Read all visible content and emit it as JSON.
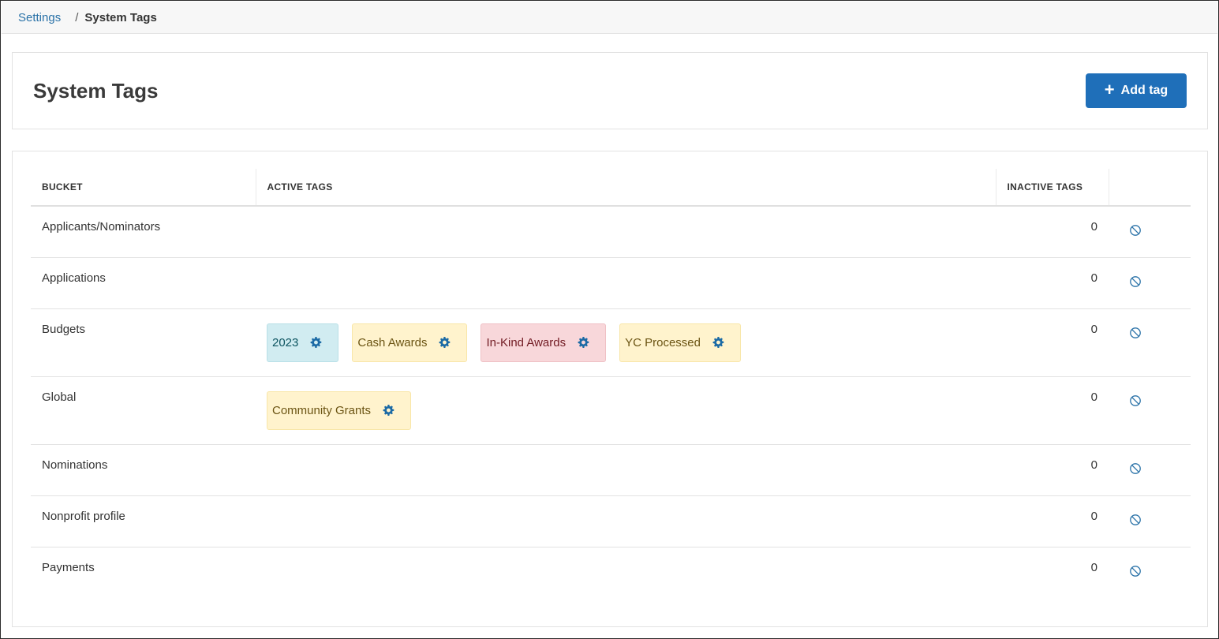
{
  "breadcrumb": {
    "parent": "Settings",
    "separator": "/",
    "current": "System Tags"
  },
  "header": {
    "title": "System Tags",
    "add_button_label": "Add tag",
    "add_button_icon": "plus-icon"
  },
  "colors": {
    "primary": "#1f6fb9",
    "link": "#2a72a8",
    "tag_info_bg": "#d1ecf1",
    "tag_warning_bg": "#fff3cd",
    "tag_danger_bg": "#f8d7da"
  },
  "table": {
    "columns": {
      "bucket": "BUCKET",
      "active": "ACTIVE TAGS",
      "inactive": "INACTIVE TAGS"
    },
    "rows": [
      {
        "bucket": "Applicants/Nominators",
        "tags": [],
        "inactive": "0"
      },
      {
        "bucket": "Applications",
        "tags": [],
        "inactive": "0"
      },
      {
        "bucket": "Budgets",
        "tags": [
          {
            "label": "2023",
            "style": "info"
          },
          {
            "label": "Cash Awards",
            "style": "warning"
          },
          {
            "label": "In-Kind Awards",
            "style": "danger"
          },
          {
            "label": "YC Processed",
            "style": "warning"
          }
        ],
        "inactive": "0"
      },
      {
        "bucket": "Global",
        "tags": [
          {
            "label": "Community Grants",
            "style": "warning"
          }
        ],
        "inactive": "0"
      },
      {
        "bucket": "Nominations",
        "tags": [],
        "inactive": "0"
      },
      {
        "bucket": "Nonprofit profile",
        "tags": [],
        "inactive": "0"
      },
      {
        "bucket": "Payments",
        "tags": [],
        "inactive": "0"
      }
    ]
  }
}
